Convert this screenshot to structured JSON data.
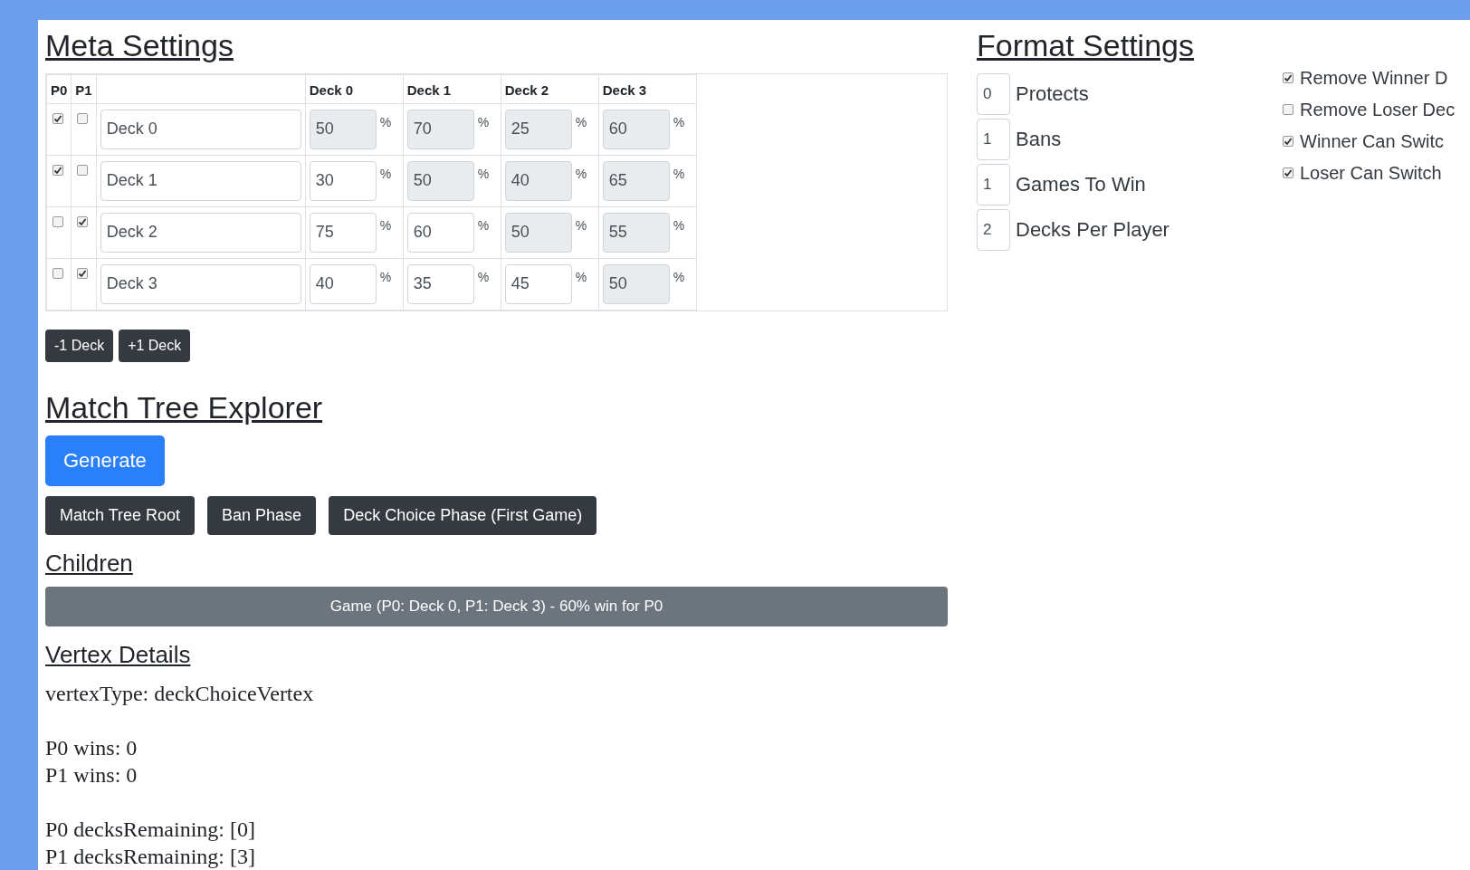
{
  "meta_settings": {
    "title": "Meta Settings",
    "player_columns": [
      "P0",
      "P1"
    ],
    "deck_columns": [
      "Deck 0",
      "Deck 1",
      "Deck 2",
      "Deck 3"
    ],
    "rows": [
      {
        "p0": true,
        "p1": false,
        "name": "Deck 0",
        "cells": [
          {
            "value": "50",
            "disabled": true,
            "unit": "%"
          },
          {
            "value": "70",
            "disabled": true,
            "unit": "%"
          },
          {
            "value": "25",
            "disabled": true,
            "unit": "%"
          },
          {
            "value": "60",
            "disabled": true,
            "unit": "%"
          }
        ]
      },
      {
        "p0": true,
        "p1": false,
        "name": "Deck 1",
        "cells": [
          {
            "value": "30",
            "disabled": false,
            "unit": "%"
          },
          {
            "value": "50",
            "disabled": true,
            "unit": "%"
          },
          {
            "value": "40",
            "disabled": true,
            "unit": "%"
          },
          {
            "value": "65",
            "disabled": true,
            "unit": "%"
          }
        ]
      },
      {
        "p0": false,
        "p1": true,
        "name": "Deck 2",
        "cells": [
          {
            "value": "75",
            "disabled": false,
            "unit": "%"
          },
          {
            "value": "60",
            "disabled": false,
            "unit": "%"
          },
          {
            "value": "50",
            "disabled": true,
            "unit": "%"
          },
          {
            "value": "55",
            "disabled": true,
            "unit": "%"
          }
        ]
      },
      {
        "p0": false,
        "p1": true,
        "name": "Deck 3",
        "cells": [
          {
            "value": "40",
            "disabled": false,
            "unit": "%"
          },
          {
            "value": "35",
            "disabled": false,
            "unit": "%"
          },
          {
            "value": "45",
            "disabled": false,
            "unit": "%"
          },
          {
            "value": "50",
            "disabled": true,
            "unit": "%"
          }
        ]
      }
    ],
    "buttons": [
      "-1 Deck",
      "+1 Deck"
    ]
  },
  "match_tree_explorer": {
    "title": "Match Tree Explorer",
    "generate_button": "Generate",
    "breadcrumbs": [
      "Match Tree Root",
      "Ban Phase",
      "Deck Choice Phase (First Game)"
    ],
    "children_title": "Children",
    "children": [
      "Game (P0: Deck 0, P1: Deck 3) - 60% win for P0"
    ],
    "vertex_details_title": "Vertex Details",
    "details": [
      [
        "vertexType: deckChoiceVertex"
      ],
      [
        "P0 wins: 0",
        "P1 wins: 0"
      ],
      [
        "P0 decksRemaining: [0]",
        "P1 decksRemaining: [3]"
      ]
    ]
  },
  "format_settings": {
    "title": "Format Settings",
    "numbers": [
      {
        "value": "0",
        "label": "Protects"
      },
      {
        "value": "1",
        "label": "Bans"
      },
      {
        "value": "1",
        "label": "Games To Win"
      },
      {
        "value": "2",
        "label": "Decks Per Player"
      }
    ],
    "options": [
      {
        "label": "Remove Winner D",
        "checked": true
      },
      {
        "label": "Remove Loser Dec",
        "checked": false
      },
      {
        "label": "Winner Can Switc",
        "checked": true
      },
      {
        "label": "Loser Can Switch",
        "checked": true
      }
    ]
  }
}
